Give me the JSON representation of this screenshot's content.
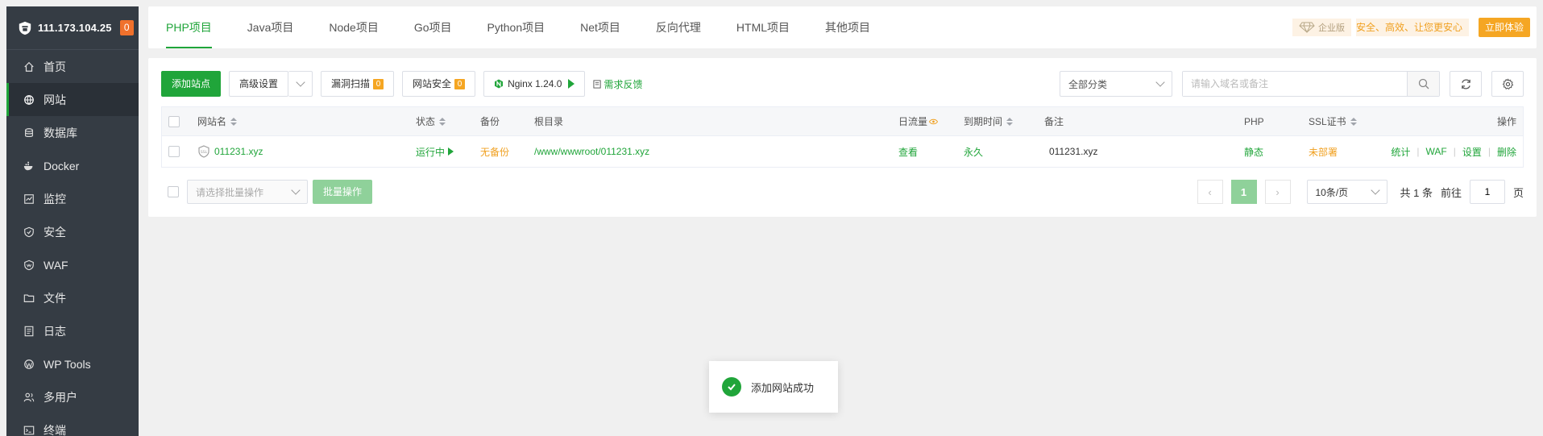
{
  "sidebar": {
    "ip": "111.173.104.25",
    "badge": "0",
    "items": [
      {
        "label": "首页",
        "icon": "home-icon"
      },
      {
        "label": "网站",
        "icon": "globe-icon"
      },
      {
        "label": "数据库",
        "icon": "database-icon"
      },
      {
        "label": "Docker",
        "icon": "docker-icon"
      },
      {
        "label": "监控",
        "icon": "monitor-icon"
      },
      {
        "label": "安全",
        "icon": "shield-icon"
      },
      {
        "label": "WAF",
        "icon": "waf-icon"
      },
      {
        "label": "文件",
        "icon": "folder-icon"
      },
      {
        "label": "日志",
        "icon": "log-icon"
      },
      {
        "label": "WP Tools",
        "icon": "wordpress-icon"
      },
      {
        "label": "多用户",
        "icon": "users-icon"
      },
      {
        "label": "终端",
        "icon": "terminal-icon"
      }
    ]
  },
  "tabs": [
    "PHP项目",
    "Java项目",
    "Node项目",
    "Go项目",
    "Python项目",
    "Net项目",
    "反向代理",
    "HTML项目",
    "其他项目"
  ],
  "promo": {
    "tag": "企业版",
    "text": "安全、高效、让您更安心",
    "button": "立即体验"
  },
  "toolbar": {
    "add_site": "添加站点",
    "advanced": "高级设置",
    "vuln_scan": "漏洞扫描",
    "vuln_count": "0",
    "site_security": "网站安全",
    "security_count": "0",
    "nginx": "Nginx 1.24.0",
    "feedback": "需求反馈",
    "category": "全部分类",
    "search_placeholder": "请输入域名或备注"
  },
  "table": {
    "headers": {
      "name": "网站名",
      "status": "状态",
      "backup": "备份",
      "root": "根目录",
      "traffic": "日流量",
      "expire": "到期时间",
      "remark": "备注",
      "php": "PHP",
      "ssl": "SSL证书",
      "ops": "操作"
    },
    "row": {
      "name": "011231.xyz",
      "status": "运行中",
      "backup": "无备份",
      "root": "/www/wwwroot/011231.xyz",
      "traffic": "查看",
      "expire": "永久",
      "remark": "011231.xyz",
      "php": "静态",
      "ssl": "未部署",
      "op_stats": "统计",
      "op_waf": "WAF",
      "op_settings": "设置",
      "op_delete": "删除"
    }
  },
  "footer": {
    "batch_placeholder": "请选择批量操作",
    "batch_btn": "批量操作",
    "page": "1",
    "page_size": "10条/页",
    "total": "共 1 条",
    "goto": "前往",
    "goto_value": "1",
    "page_unit": "页"
  },
  "toast": {
    "message": "添加网站成功"
  },
  "colors": {
    "accent": "#20a53a",
    "warning": "#f0a020",
    "sidebar": "#353c44"
  }
}
